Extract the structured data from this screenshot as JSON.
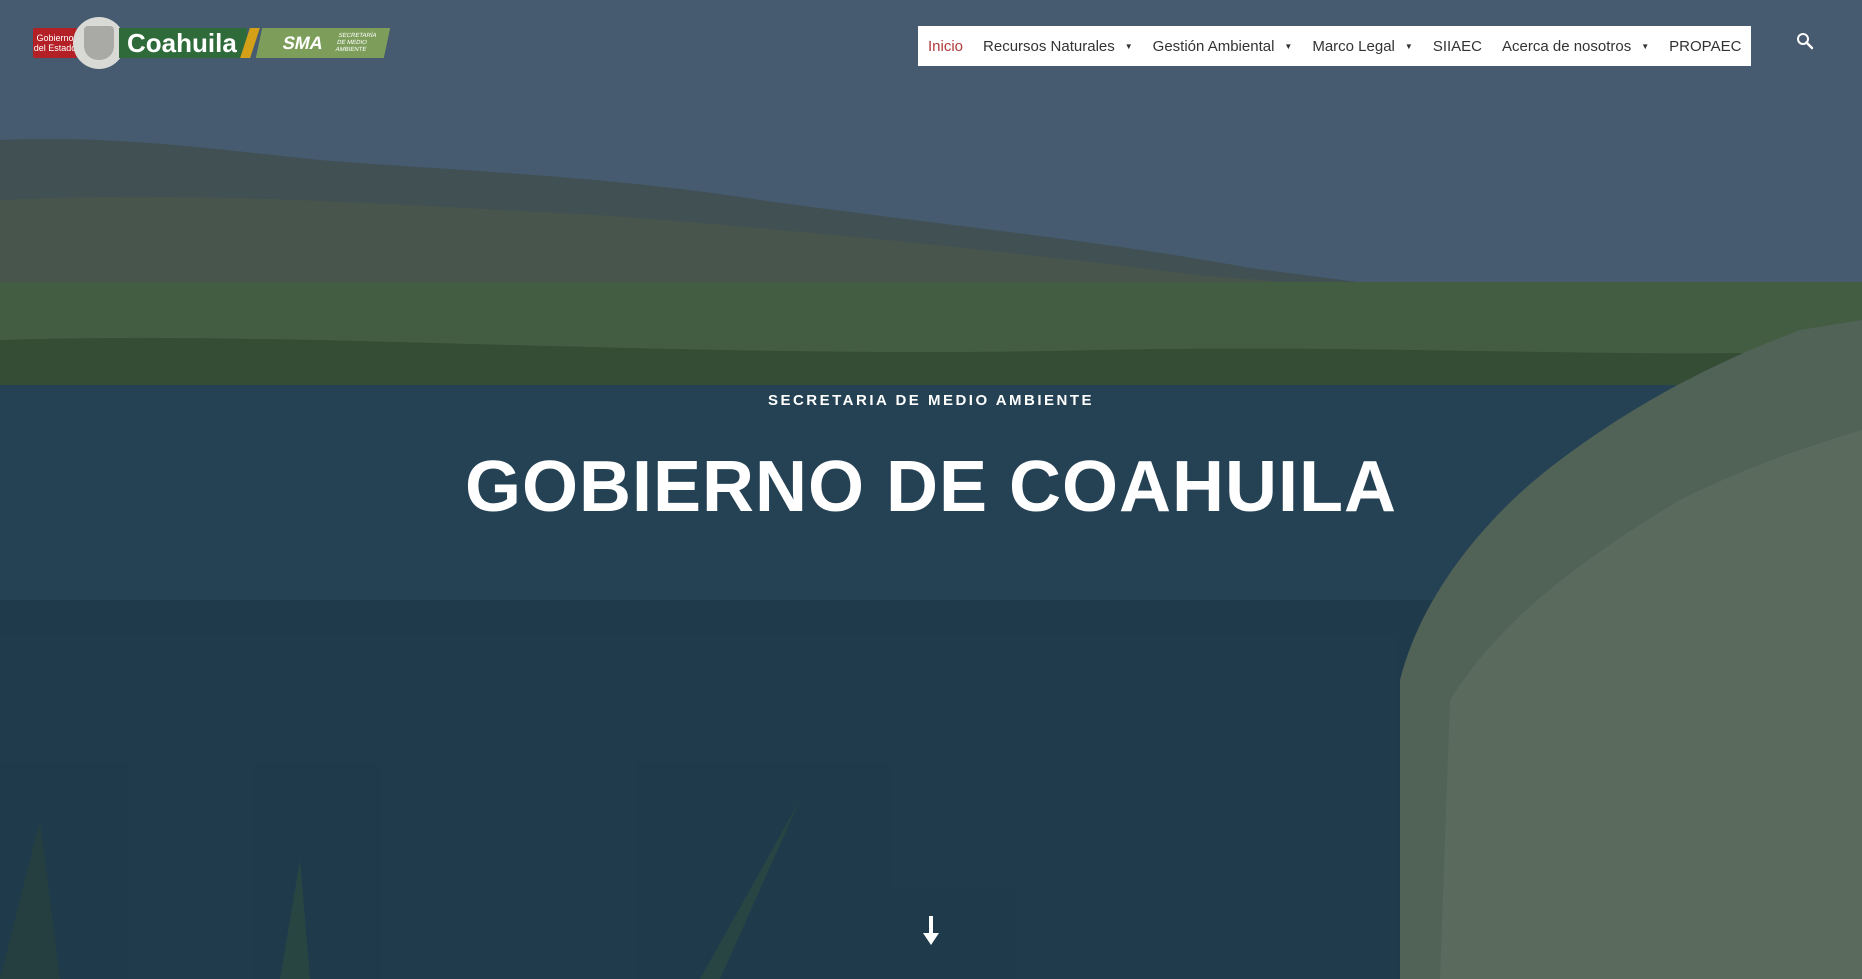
{
  "logo": {
    "gobierno_text": "Gobierno del Estado",
    "state_text": "Coahuila",
    "sma_text": "SMA",
    "sma_sub_text": "SECRETARÍA DE MEDIO AMBIENTE"
  },
  "nav": {
    "items": [
      {
        "label": "Inicio",
        "active": true,
        "dropdown": false
      },
      {
        "label": "Recursos Naturales",
        "dropdown": true
      },
      {
        "label": "Gestión Ambiental",
        "dropdown": true
      },
      {
        "label": "Marco Legal",
        "dropdown": true
      },
      {
        "label": "SIIAEC",
        "dropdown": false
      },
      {
        "label": "Acerca de nosotros",
        "dropdown": true
      },
      {
        "label": "PROPAEC",
        "dropdown": false
      }
    ],
    "search_icon": "search-icon",
    "active_color": "#b03a3a"
  },
  "hero": {
    "subtitle": "SECRETARIA DE MEDIO AMBIENTE",
    "title": "GOBIERNO DE COAHUILA",
    "scroll_icon": "arrow-down-icon"
  }
}
